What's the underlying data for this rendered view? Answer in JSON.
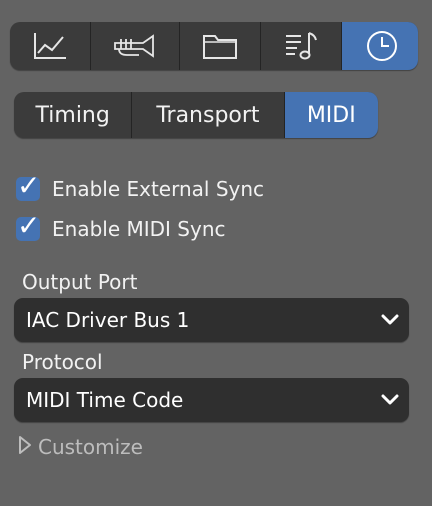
{
  "toolbar": {
    "items": [
      {
        "icon": "chart-icon"
      },
      {
        "icon": "trumpet-icon"
      },
      {
        "icon": "folder-icon"
      },
      {
        "icon": "music-list-icon"
      },
      {
        "icon": "clock-icon",
        "active": true
      }
    ]
  },
  "tabs": {
    "timing": "Timing",
    "transport": "Transport",
    "midi": "MIDI",
    "active": "MIDI"
  },
  "options": {
    "external_sync_label": "Enable External Sync",
    "external_sync_checked": true,
    "midi_sync_label": "Enable MIDI Sync",
    "midi_sync_checked": true
  },
  "output_port": {
    "label": "Output Port",
    "value": "IAC Driver Bus 1"
  },
  "protocol": {
    "label": "Protocol",
    "value": "MIDI Time Code"
  },
  "customize": {
    "label": "Customize"
  },
  "colors": {
    "background": "#636363",
    "accent": "#4573b3",
    "control_bg": "#3b3b3b"
  }
}
